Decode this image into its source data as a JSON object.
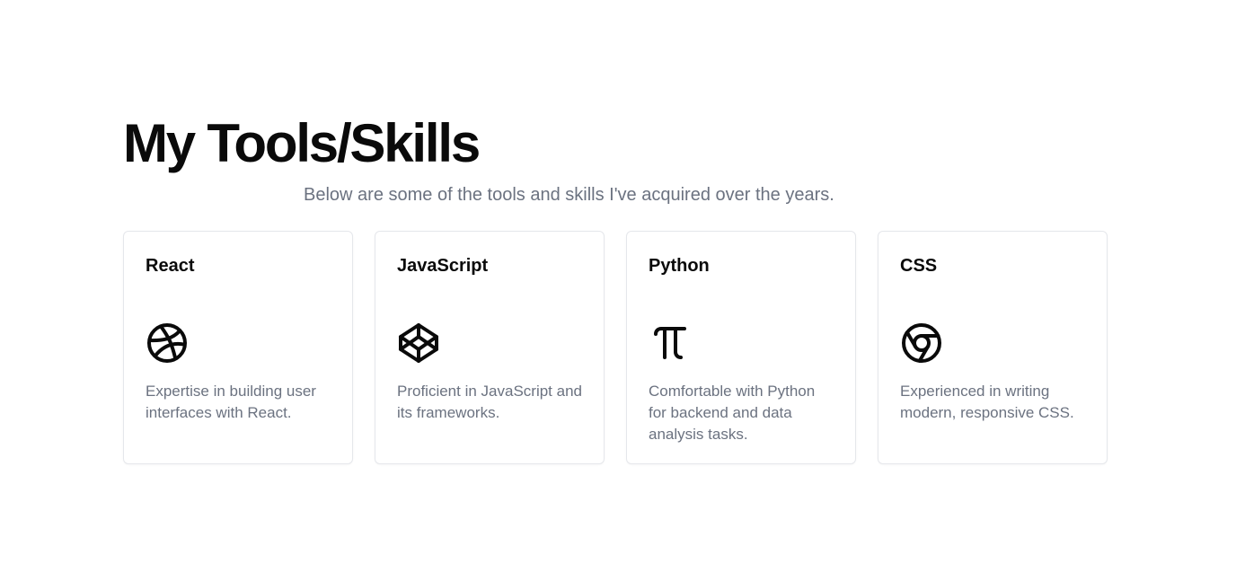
{
  "header": {
    "title": "My Tools/Skills",
    "subtitle": "Below are some of the tools and skills I've acquired over the years."
  },
  "cards": [
    {
      "title": "React",
      "icon": "dribbble-icon",
      "description": "Expertise in building user interfaces with React."
    },
    {
      "title": "JavaScript",
      "icon": "codepen-icon",
      "description": "Proficient in JavaScript and its frameworks."
    },
    {
      "title": "Python",
      "icon": "pi-icon",
      "description": "Comfortable with Python for backend and data analysis tasks."
    },
    {
      "title": "CSS",
      "icon": "chrome-icon",
      "description": "Experienced in writing modern, responsive CSS."
    }
  ],
  "colors": {
    "text_primary": "#0a0a0a",
    "text_muted": "#6b7280",
    "card_border": "#e5e7eb",
    "background": "#ffffff"
  }
}
